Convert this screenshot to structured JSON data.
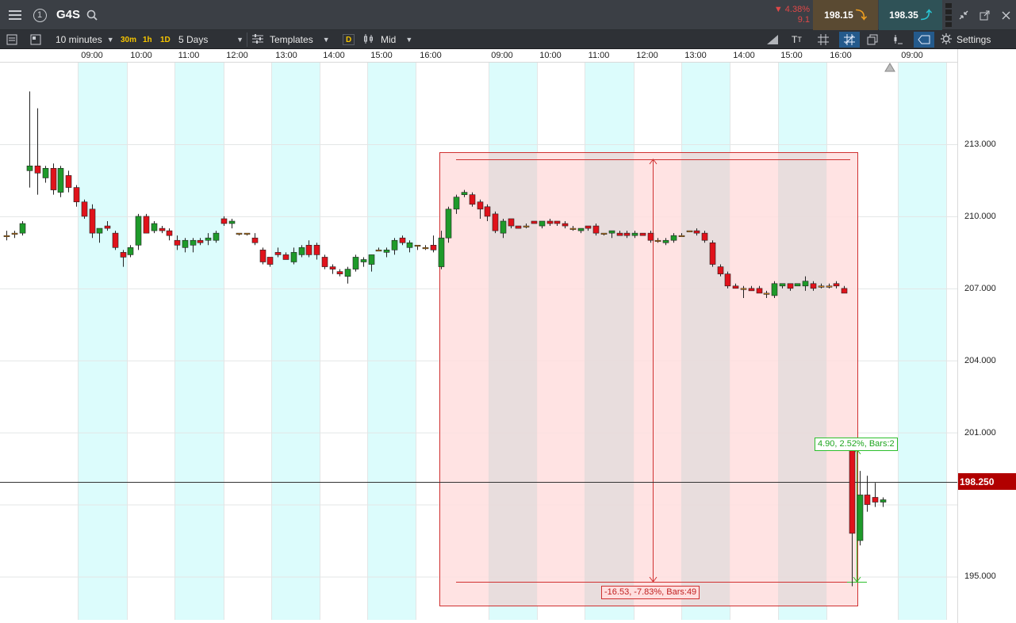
{
  "header": {
    "menu_icon": "hamburger-menu-icon",
    "alert_badge": "1",
    "symbol": "G4S",
    "change_percent": "▼ 4.38%",
    "change_points": "9.1",
    "sell_price": "198.15",
    "buy_price": "198.35"
  },
  "toolbar": {
    "interval": "10 minutes",
    "quick_30m": "30m",
    "quick_1h": "1h",
    "quick_1d": "1D",
    "range": "5 Days",
    "templates": "Templates",
    "d_badge": "D",
    "price_mode": "Mid",
    "settings": "Settings"
  },
  "time_axis": {
    "labels": [
      "09:00",
      "10:00",
      "11:00",
      "12:00",
      "13:00",
      "14:00",
      "15:00",
      "16:00",
      "09:00",
      "10:00",
      "11:00",
      "12:00",
      "13:00",
      "14:00",
      "15:00",
      "16:00",
      "09:00"
    ]
  },
  "price_axis": {
    "labels": [
      "213.000",
      "210.000",
      "207.000",
      "204.000",
      "201.000",
      "195.000"
    ],
    "current_price": "198.250"
  },
  "measurements": {
    "down": "-16.53, -7.83%, Bars:49",
    "up": "4.90, 2.52%, Bars:2"
  },
  "colors": {
    "up_candle": "#1e9a2a",
    "down_candle": "#e0121b",
    "session_shade": "#dcfcfc",
    "measure_down_fill": "#ffdede",
    "measure_border": "#d03030",
    "measure_up": "#2cbf2c",
    "current_price_bg": "#b10000"
  },
  "chart_data": {
    "type": "candlestick",
    "y_unit": "price",
    "ylim": [
      193.2,
      216.4
    ],
    "grid": true,
    "candles": [
      {
        "o": 209.2,
        "h": 209.4,
        "l": 209.0,
        "c": 209.2
      },
      {
        "o": 209.3,
        "h": 209.4,
        "l": 209.1,
        "c": 209.3
      },
      {
        "o": 209.3,
        "h": 209.8,
        "l": 209.2,
        "c": 209.7
      },
      {
        "o": 211.9,
        "h": 215.2,
        "l": 211.2,
        "c": 212.1
      },
      {
        "o": 212.1,
        "h": 214.5,
        "l": 210.9,
        "c": 211.8
      },
      {
        "o": 211.6,
        "h": 212.1,
        "l": 211.4,
        "c": 212.0
      },
      {
        "o": 212.0,
        "h": 212.2,
        "l": 210.9,
        "c": 211.1
      },
      {
        "o": 211.0,
        "h": 212.1,
        "l": 210.8,
        "c": 212.0
      },
      {
        "o": 211.7,
        "h": 211.9,
        "l": 211.0,
        "c": 211.2
      },
      {
        "o": 211.2,
        "h": 211.3,
        "l": 210.4,
        "c": 210.6
      },
      {
        "o": 210.6,
        "h": 210.7,
        "l": 209.9,
        "c": 210.0
      },
      {
        "o": 210.3,
        "h": 210.5,
        "l": 209.1,
        "c": 209.3
      },
      {
        "o": 209.3,
        "h": 209.4,
        "l": 208.9,
        "c": 209.5
      },
      {
        "o": 209.6,
        "h": 209.8,
        "l": 209.4,
        "c": 209.5
      },
      {
        "o": 209.3,
        "h": 209.4,
        "l": 208.6,
        "c": 208.7
      },
      {
        "o": 208.5,
        "h": 208.6,
        "l": 207.9,
        "c": 208.3
      },
      {
        "o": 208.4,
        "h": 208.8,
        "l": 208.3,
        "c": 208.7
      },
      {
        "o": 208.8,
        "h": 210.1,
        "l": 208.6,
        "c": 210.0
      },
      {
        "o": 210.0,
        "h": 210.1,
        "l": 209.3,
        "c": 209.3
      },
      {
        "o": 209.4,
        "h": 209.8,
        "l": 209.3,
        "c": 209.7
      },
      {
        "o": 209.5,
        "h": 209.6,
        "l": 209.3,
        "c": 209.4
      },
      {
        "o": 209.4,
        "h": 209.5,
        "l": 209.0,
        "c": 209.2
      },
      {
        "o": 209.0,
        "h": 209.2,
        "l": 208.6,
        "c": 208.8
      },
      {
        "o": 208.7,
        "h": 209.1,
        "l": 208.5,
        "c": 209.0
      },
      {
        "o": 208.8,
        "h": 209.1,
        "l": 208.5,
        "c": 209.0
      },
      {
        "o": 209.0,
        "h": 209.1,
        "l": 208.8,
        "c": 208.9
      },
      {
        "o": 209.0,
        "h": 209.3,
        "l": 208.8,
        "c": 209.1
      },
      {
        "o": 209.0,
        "h": 209.4,
        "l": 208.9,
        "c": 209.3
      },
      {
        "o": 209.9,
        "h": 210.0,
        "l": 209.6,
        "c": 209.7
      },
      {
        "o": 209.7,
        "h": 209.9,
        "l": 209.5,
        "c": 209.8
      },
      {
        "o": 209.3,
        "h": 209.3,
        "l": 209.2,
        "c": 209.3
      },
      {
        "o": 209.3,
        "h": 209.3,
        "l": 209.2,
        "c": 209.3
      },
      {
        "o": 209.1,
        "h": 209.3,
        "l": 208.8,
        "c": 208.9
      },
      {
        "o": 208.6,
        "h": 208.7,
        "l": 208.0,
        "c": 208.1
      },
      {
        "o": 208.3,
        "h": 208.3,
        "l": 207.9,
        "c": 208.0
      },
      {
        "o": 208.5,
        "h": 208.7,
        "l": 208.3,
        "c": 208.4
      },
      {
        "o": 208.4,
        "h": 208.5,
        "l": 208.2,
        "c": 208.2
      },
      {
        "o": 208.1,
        "h": 208.7,
        "l": 208.0,
        "c": 208.5
      },
      {
        "o": 208.4,
        "h": 208.8,
        "l": 208.3,
        "c": 208.7
      },
      {
        "o": 208.8,
        "h": 209.0,
        "l": 208.3,
        "c": 208.4
      },
      {
        "o": 208.8,
        "h": 208.9,
        "l": 208.2,
        "c": 208.4
      },
      {
        "o": 208.3,
        "h": 208.4,
        "l": 207.8,
        "c": 207.9
      },
      {
        "o": 207.9,
        "h": 208.0,
        "l": 207.6,
        "c": 207.8
      },
      {
        "o": 207.7,
        "h": 207.8,
        "l": 207.5,
        "c": 207.6
      },
      {
        "o": 207.5,
        "h": 207.9,
        "l": 207.2,
        "c": 207.8
      },
      {
        "o": 207.8,
        "h": 208.4,
        "l": 207.7,
        "c": 208.3
      },
      {
        "o": 208.1,
        "h": 208.3,
        "l": 207.9,
        "c": 208.2
      },
      {
        "o": 208.0,
        "h": 208.4,
        "l": 207.7,
        "c": 208.4
      },
      {
        "o": 208.6,
        "h": 208.7,
        "l": 208.6,
        "c": 208.6
      },
      {
        "o": 208.5,
        "h": 208.7,
        "l": 208.3,
        "c": 208.6
      },
      {
        "o": 208.6,
        "h": 209.1,
        "l": 208.4,
        "c": 209.0
      },
      {
        "o": 209.1,
        "h": 209.2,
        "l": 208.8,
        "c": 208.9
      },
      {
        "o": 208.7,
        "h": 209.0,
        "l": 208.5,
        "c": 208.9
      },
      {
        "o": 208.8,
        "h": 208.8,
        "l": 208.6,
        "c": 208.8
      },
      {
        "o": 208.7,
        "h": 208.8,
        "l": 208.6,
        "c": 208.7
      },
      {
        "o": 208.8,
        "h": 209.2,
        "l": 208.5,
        "c": 208.6
      },
      {
        "o": 207.9,
        "h": 209.4,
        "l": 207.8,
        "c": 209.1
      },
      {
        "o": 209.1,
        "h": 210.4,
        "l": 208.9,
        "c": 210.3
      },
      {
        "o": 210.3,
        "h": 210.9,
        "l": 210.1,
        "c": 210.8
      },
      {
        "o": 210.9,
        "h": 211.1,
        "l": 210.8,
        "c": 211.0
      },
      {
        "o": 210.9,
        "h": 211.0,
        "l": 210.4,
        "c": 210.5
      },
      {
        "o": 210.6,
        "h": 210.7,
        "l": 209.9,
        "c": 210.3
      },
      {
        "o": 210.4,
        "h": 210.5,
        "l": 209.8,
        "c": 210.0
      },
      {
        "o": 210.1,
        "h": 210.2,
        "l": 209.3,
        "c": 209.4
      },
      {
        "o": 209.3,
        "h": 209.9,
        "l": 209.1,
        "c": 209.8
      },
      {
        "o": 209.9,
        "h": 209.9,
        "l": 209.5,
        "c": 209.6
      },
      {
        "o": 209.6,
        "h": 209.6,
        "l": 209.5,
        "c": 209.5
      },
      {
        "o": 209.6,
        "h": 209.7,
        "l": 209.5,
        "c": 209.6
      },
      {
        "o": 209.8,
        "h": 209.8,
        "l": 209.7,
        "c": 209.7
      },
      {
        "o": 209.6,
        "h": 209.8,
        "l": 209.5,
        "c": 209.8
      },
      {
        "o": 209.8,
        "h": 209.9,
        "l": 209.6,
        "c": 209.7
      },
      {
        "o": 209.8,
        "h": 209.8,
        "l": 209.6,
        "c": 209.7
      },
      {
        "o": 209.7,
        "h": 209.8,
        "l": 209.5,
        "c": 209.6
      },
      {
        "o": 209.5,
        "h": 209.6,
        "l": 209.4,
        "c": 209.5
      },
      {
        "o": 209.4,
        "h": 209.5,
        "l": 209.3,
        "c": 209.5
      },
      {
        "o": 209.6,
        "h": 209.6,
        "l": 209.4,
        "c": 209.5
      },
      {
        "o": 209.6,
        "h": 209.7,
        "l": 209.2,
        "c": 209.3
      },
      {
        "o": 209.3,
        "h": 209.3,
        "l": 209.2,
        "c": 209.3
      },
      {
        "o": 209.3,
        "h": 209.4,
        "l": 209.1,
        "c": 209.4
      },
      {
        "o": 209.3,
        "h": 209.4,
        "l": 209.2,
        "c": 209.2
      },
      {
        "o": 209.3,
        "h": 209.4,
        "l": 209.1,
        "c": 209.2
      },
      {
        "o": 209.2,
        "h": 209.4,
        "l": 209.1,
        "c": 209.3
      },
      {
        "o": 209.3,
        "h": 209.3,
        "l": 209.2,
        "c": 209.2
      },
      {
        "o": 209.3,
        "h": 209.4,
        "l": 208.9,
        "c": 209.0
      },
      {
        "o": 209.0,
        "h": 209.1,
        "l": 208.9,
        "c": 209.0
      },
      {
        "o": 208.9,
        "h": 209.1,
        "l": 208.8,
        "c": 209.0
      },
      {
        "o": 209.0,
        "h": 209.3,
        "l": 208.9,
        "c": 209.2
      },
      {
        "o": 209.2,
        "h": 209.3,
        "l": 209.2,
        "c": 209.2
      },
      {
        "o": 209.4,
        "h": 209.4,
        "l": 209.4,
        "c": 209.4
      },
      {
        "o": 209.4,
        "h": 209.5,
        "l": 209.2,
        "c": 209.3
      },
      {
        "o": 209.3,
        "h": 209.4,
        "l": 208.9,
        "c": 209.0
      },
      {
        "o": 208.9,
        "h": 209.0,
        "l": 207.9,
        "c": 208.0
      },
      {
        "o": 207.9,
        "h": 208.0,
        "l": 207.5,
        "c": 207.6
      },
      {
        "o": 207.6,
        "h": 207.7,
        "l": 207.0,
        "c": 207.1
      },
      {
        "o": 207.1,
        "h": 207.2,
        "l": 207.0,
        "c": 207.0
      },
      {
        "o": 207.0,
        "h": 207.1,
        "l": 206.6,
        "c": 207.0
      },
      {
        "o": 207.0,
        "h": 207.1,
        "l": 206.9,
        "c": 206.9
      },
      {
        "o": 207.0,
        "h": 207.1,
        "l": 206.9,
        "c": 206.8
      },
      {
        "o": 206.8,
        "h": 206.9,
        "l": 206.6,
        "c": 206.8
      },
      {
        "o": 206.7,
        "h": 207.3,
        "l": 206.6,
        "c": 207.2
      },
      {
        "o": 207.1,
        "h": 207.2,
        "l": 207.0,
        "c": 207.2
      },
      {
        "o": 207.2,
        "h": 207.2,
        "l": 206.9,
        "c": 207.0
      },
      {
        "o": 207.1,
        "h": 207.2,
        "l": 207.1,
        "c": 207.2
      },
      {
        "o": 207.1,
        "h": 207.5,
        "l": 206.9,
        "c": 207.3
      },
      {
        "o": 207.2,
        "h": 207.3,
        "l": 206.9,
        "c": 207.0
      },
      {
        "o": 207.1,
        "h": 207.2,
        "l": 207.0,
        "c": 207.1
      },
      {
        "o": 207.1,
        "h": 207.2,
        "l": 207.0,
        "c": 207.1
      },
      {
        "o": 207.2,
        "h": 207.3,
        "l": 207.0,
        "c": 207.1
      },
      {
        "o": 207.0,
        "h": 207.1,
        "l": 206.8,
        "c": 206.8
      },
      {
        "o": 200.5,
        "h": 200.5,
        "l": 194.6,
        "c": 196.8
      },
      {
        "o": 196.5,
        "h": 199.4,
        "l": 196.3,
        "c": 198.4
      },
      {
        "o": 198.4,
        "h": 199.2,
        "l": 197.7,
        "c": 198.0
      },
      {
        "o": 198.3,
        "h": 198.9,
        "l": 197.9,
        "c": 198.1
      },
      {
        "o": 198.1,
        "h": 198.3,
        "l": 197.9,
        "c": 198.2
      }
    ]
  }
}
